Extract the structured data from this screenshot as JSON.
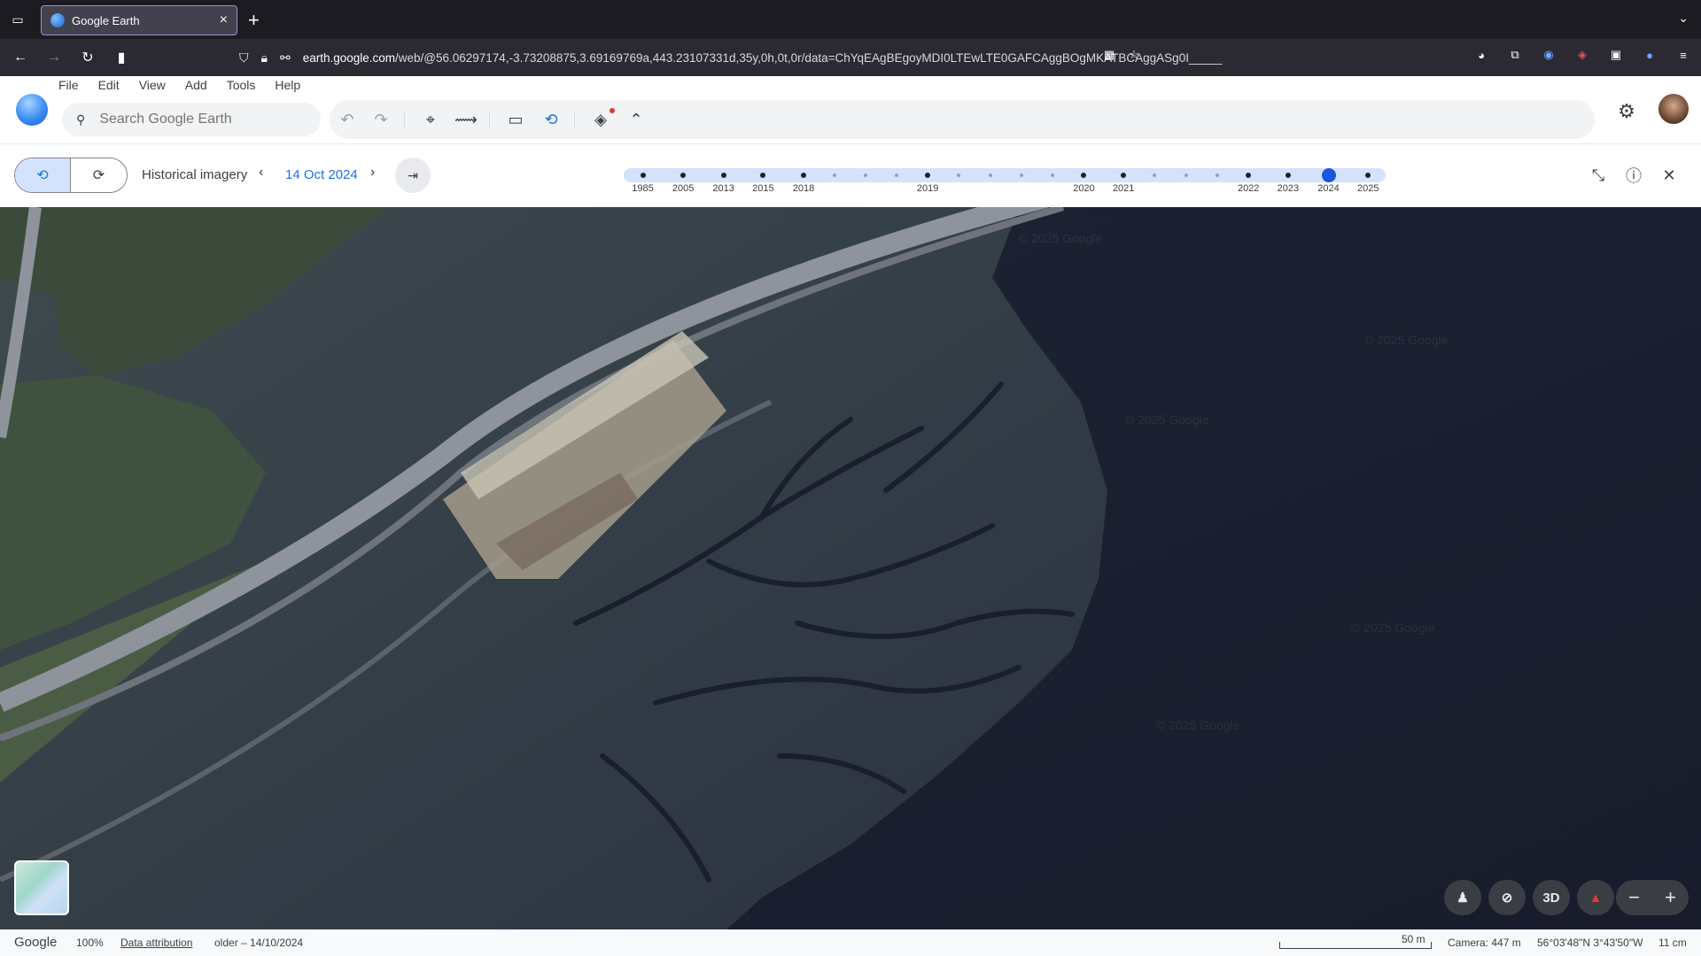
{
  "browser": {
    "tab_title": "Google Earth",
    "url_host": "earth.google.com",
    "url_prefix": "",
    "url_rest": "/web/@56.06297174,-3.73208875,3.69169769a,443.23107331d,35y,0h,0t,0r/data=ChYqEAgBEgoyMDI0LTEwLTE0GAFCAggBOgMKATBCAggASg0I_____"
  },
  "app": {
    "menu": [
      "File",
      "Edit",
      "View",
      "Add",
      "Tools",
      "Help"
    ],
    "search_placeholder": "Search Google Earth"
  },
  "historical": {
    "label": "Historical imagery",
    "date": "14 Oct 2024",
    "timeline_years": [
      {
        "label": "1985",
        "pos": 0.025
      },
      {
        "label": "2005",
        "pos": 0.078
      },
      {
        "label": "2013",
        "pos": 0.131
      },
      {
        "label": "2015",
        "pos": 0.183
      },
      {
        "label": "2018",
        "pos": 0.236
      },
      {
        "label": "2019",
        "pos": 0.399
      },
      {
        "label": "2020",
        "pos": 0.604
      },
      {
        "label": "2021",
        "pos": 0.656
      },
      {
        "label": "2022",
        "pos": 0.82
      },
      {
        "label": "2023",
        "pos": 0.872
      },
      {
        "label": "2024",
        "pos": 0.925
      },
      {
        "label": "2025",
        "pos": 0.977
      }
    ],
    "minor_dots": [
      0.277,
      0.318,
      0.358,
      0.44,
      0.481,
      0.522,
      0.563,
      0.697,
      0.738,
      0.779
    ],
    "selected_year": "2024"
  },
  "map": {
    "watermark": "© 2025 Google",
    "controls": {
      "three_d": "3D"
    }
  },
  "status": {
    "brand": "Google",
    "zoom": "100%",
    "attribution_link": "Data attribution",
    "imagery_date": "older – 14/10/2024",
    "scale": "50 m",
    "camera": "Camera: 447 m",
    "coords": "56°03'48\"N 3°43'50\"W",
    "elevation": "11 cm"
  }
}
